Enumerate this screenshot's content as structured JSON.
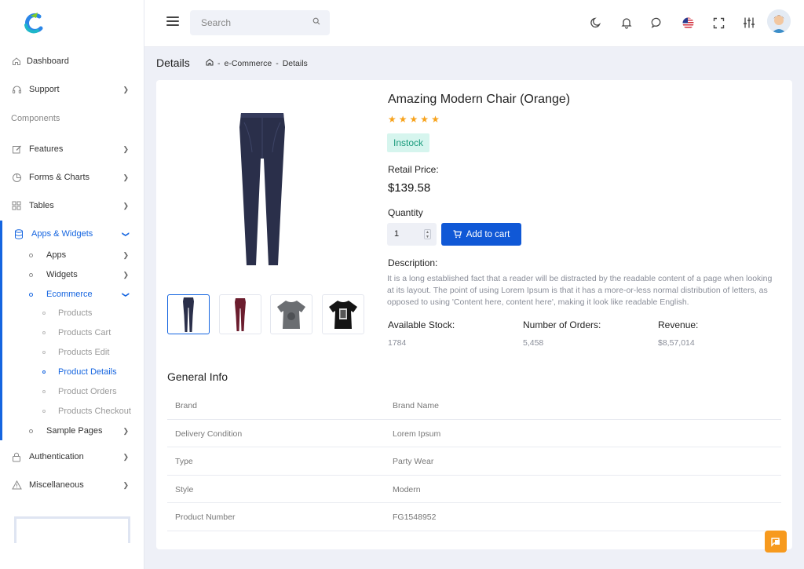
{
  "sidebar": {
    "items": [
      {
        "label": "Dashboard"
      },
      {
        "label": "Support"
      },
      {
        "label": "Features"
      },
      {
        "label": "Forms & Charts"
      },
      {
        "label": "Tables"
      },
      {
        "label": "Apps & Widgets"
      },
      {
        "label": "Authentication"
      },
      {
        "label": "Miscellaneous"
      }
    ],
    "section_label": "Components",
    "sub_items": [
      {
        "label": "Apps"
      },
      {
        "label": "Widgets"
      },
      {
        "label": "Ecommerce"
      },
      {
        "label": "Sample Pages"
      }
    ],
    "ecommerce_items": [
      {
        "label": "Products"
      },
      {
        "label": "Products Cart"
      },
      {
        "label": "Products Edit"
      },
      {
        "label": "Product Details"
      },
      {
        "label": "Product Orders"
      },
      {
        "label": "Products Checkout"
      }
    ]
  },
  "header": {
    "search_placeholder": "Search"
  },
  "page": {
    "title": "Details",
    "breadcrumb": [
      "e-Commerce",
      "Details"
    ]
  },
  "product": {
    "title": "Amazing Modern Chair (Orange)",
    "rating": 5,
    "stock_badge": "Instock",
    "retail_price_label": "Retail Price:",
    "price": "$139.58",
    "quantity_label": "Quantity",
    "quantity": "1",
    "add_to_cart": "Add to cart",
    "description_label": "Description:",
    "description": "It is a long established fact that a reader will be distracted by the readable content of a page when looking at its layout. The point of using Lorem Ipsum is that it has a more-or-less normal distribution of letters, as opposed to using 'Content here, content here', making it look like readable English.",
    "stats": [
      {
        "label": "Available Stock:",
        "value": "1784"
      },
      {
        "label": "Number of Orders:",
        "value": "5,458"
      },
      {
        "label": "Revenue:",
        "value": "$8,57,014"
      }
    ]
  },
  "general_info": {
    "title": "General Info",
    "rows": [
      {
        "key": "Brand",
        "value": "Brand Name"
      },
      {
        "key": "Delivery Condition",
        "value": "Lorem Ipsum"
      },
      {
        "key": "Type",
        "value": "Party Wear"
      },
      {
        "key": "Style",
        "value": "Modern"
      },
      {
        "key": "Product Number",
        "value": "FG1548952"
      }
    ]
  },
  "colors": {
    "primary": "#1058d6",
    "star": "#f7a21b",
    "success_bg": "#d6f5ee",
    "success_text": "#1a9b7c",
    "fab": "#f79a1e"
  }
}
